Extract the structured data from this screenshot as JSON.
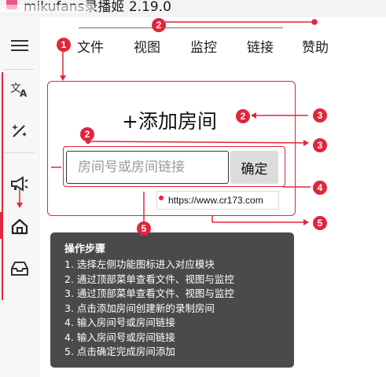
{
  "window": {
    "title": "mikufans录播姬 2.19.0"
  },
  "sidebar": {
    "items": [
      {
        "icon": "hamburger-menu-icon",
        "glyph": "☰"
      },
      {
        "icon": "translate-icon",
        "glyph": "文A"
      },
      {
        "icon": "magic-wand-icon",
        "glyph": "✨"
      },
      {
        "icon": "megaphone-icon",
        "glyph": "📢"
      },
      {
        "icon": "home-icon",
        "glyph": "⌂"
      },
      {
        "icon": "inbox-tray-icon",
        "glyph": "🗃"
      }
    ]
  },
  "menu": {
    "items": [
      "文件",
      "视图",
      "监控",
      "链接",
      "赞助"
    ]
  },
  "main": {
    "add_room_plus": "+",
    "add_room_title": "添加房间",
    "input_placeholder": "房间号或房间链接",
    "confirm_label": "确定",
    "url": "https://www.cr173.com"
  },
  "steps": {
    "title": "操作步骤",
    "lines": [
      "1. 选择左侧功能图标进入对应模块",
      "2. 通过顶部菜单查看文件、视图与监控",
      "3. 通过顶部菜单查看文件、视图与监控",
      "3. 点击添加房间创建新的录制房间",
      "4. 输入房间号或房间链接",
      "4. 输入房间号或房间链接",
      "5. 点击确定完成房间添加"
    ]
  },
  "annotations": {
    "badges": [
      "1",
      "2",
      "2",
      "2",
      "3",
      "3",
      "4",
      "5",
      "5"
    ],
    "color": "#e0263c"
  }
}
